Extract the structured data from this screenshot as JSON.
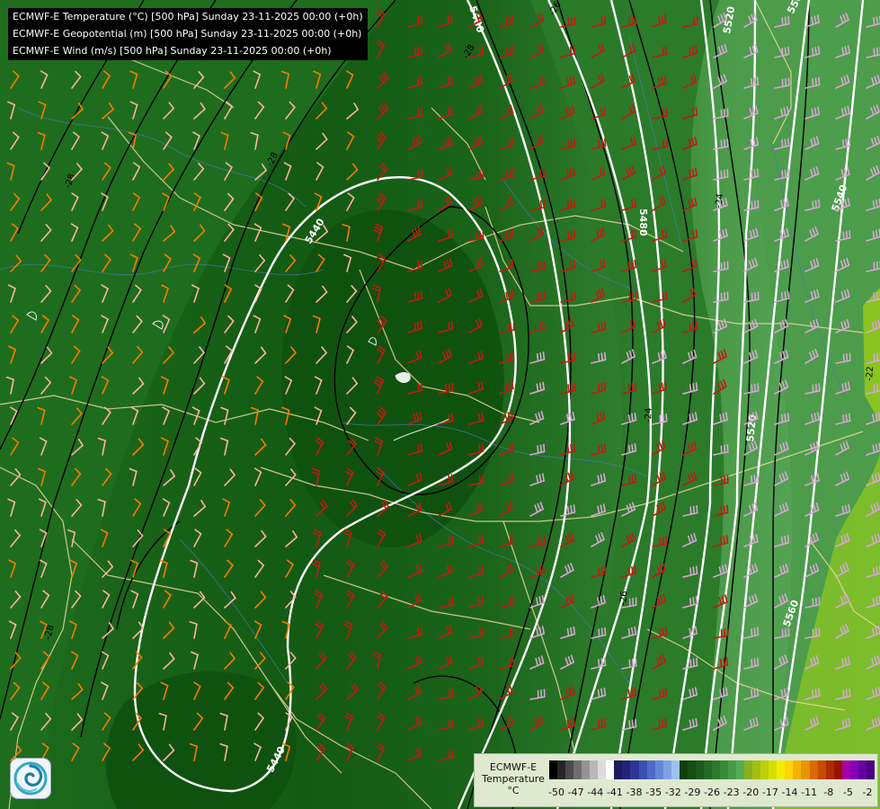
{
  "header": {
    "lines": [
      "ECMWF-E Temperature (°C) [500 hPa] Sunday 23-11-2025 00:00 (+0h)",
      "ECMWF-E Geopotential (m) [500 hPa] Sunday 23-11-2025 00:00 (+0h)",
      "ECMWF-E Wind (m/s) [500 hPa] Sunday 23-11-2025 00:00 (+0h)"
    ]
  },
  "contour_labels": {
    "geopotential": [
      "5440",
      "5440",
      "5480",
      "5480",
      "5520",
      "5520",
      "5540",
      "5560",
      "5560"
    ],
    "temperature": [
      "-28",
      "-28",
      "-28",
      "-28",
      "-26",
      "-26",
      "-24",
      "-24",
      "-22"
    ]
  },
  "colorbar": {
    "title": [
      "ECMWF-E",
      "Temperature",
      "°C"
    ],
    "tick_labels": [
      "-50",
      "-47",
      "-44",
      "-41",
      "-38",
      "-35",
      "-32",
      "-29",
      "-26",
      "-23",
      "-20",
      "-17",
      "-14",
      "-11",
      "-8",
      "-5",
      "-2"
    ],
    "colors": [
      "#000000",
      "#262626",
      "#4a4a4a",
      "#6e6e6e",
      "#939393",
      "#b8b8b8",
      "#dcdcdc",
      "#ffffff",
      "#1c1c5e",
      "#23237a",
      "#2e3596",
      "#3a4fb0",
      "#4c6ac8",
      "#6486d8",
      "#7fa2e4",
      "#9ec2f0",
      "#0f3f0f",
      "#154d15",
      "#1c5b1c",
      "#246a24",
      "#2d7a2d",
      "#388a38",
      "#469b46",
      "#56ac56",
      "#8ab01e",
      "#a3c014",
      "#bcd00a",
      "#d6e000",
      "#f0ee00",
      "#ffd400",
      "#f2b400",
      "#e69400",
      "#d86a00",
      "#c64a00",
      "#b02a00",
      "#961400",
      "#a800a8",
      "#8400b4",
      "#6400a0",
      "#4a0080"
    ]
  },
  "colors": {
    "contour_geopotential": "#ffffff",
    "contour_temperature": "#000000",
    "borders": "#f0d8a0",
    "rivers": "#4a7ab0"
  },
  "icons": {
    "logo": "ecmwf-swirl-icon"
  }
}
